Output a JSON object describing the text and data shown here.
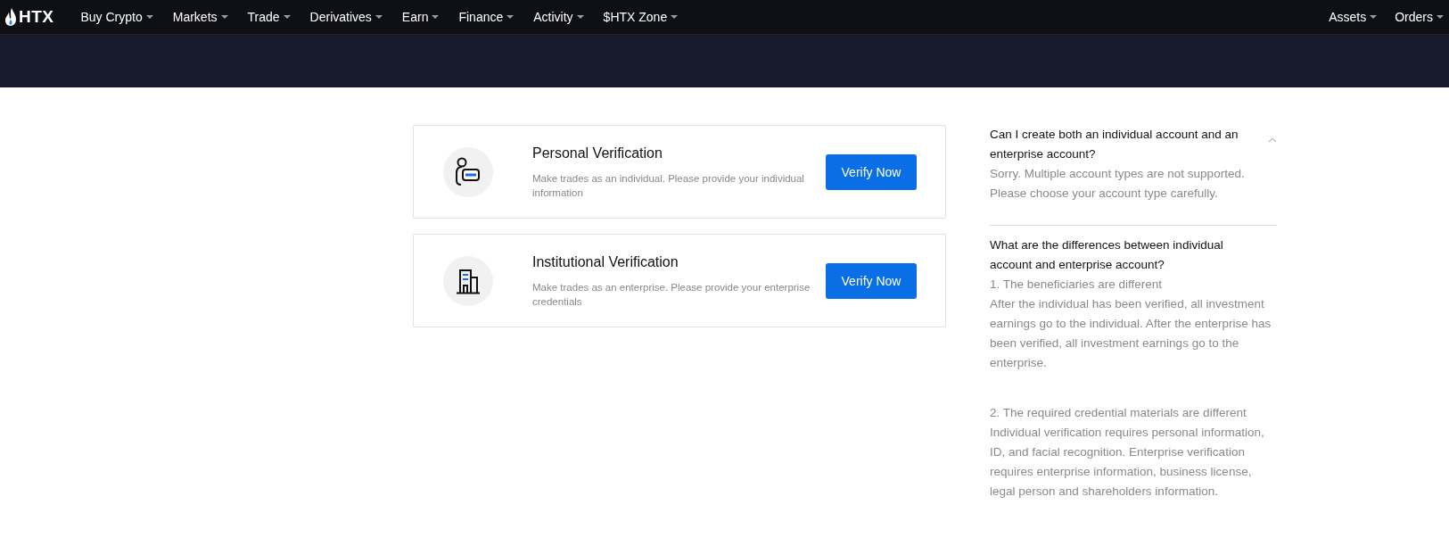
{
  "nav": {
    "logo": "HTX",
    "items": [
      {
        "label": "Buy Crypto"
      },
      {
        "label": "Markets"
      },
      {
        "label": "Trade"
      },
      {
        "label": "Derivatives"
      },
      {
        "label": "Earn"
      },
      {
        "label": "Finance"
      },
      {
        "label": "Activity"
      },
      {
        "label": "$HTX Zone"
      }
    ],
    "right_items": [
      {
        "label": "Assets"
      },
      {
        "label": "Orders"
      }
    ]
  },
  "cards": [
    {
      "kind": "personal",
      "title": "Personal Verification",
      "description": "Make trades as an individual. Please provide your individual information",
      "button": "Verify Now"
    },
    {
      "kind": "institutional",
      "title": "Institutional Verification",
      "description": "Make trades as an enterprise. Please provide your enterprise credentials",
      "button": "Verify Now"
    }
  ],
  "faq": [
    {
      "question": "Can I create both an individual account and an enterprise account?",
      "expanded": true,
      "answer": [
        {
          "heading": "Sorry. Multiple account types are not supported.",
          "text": "Please choose your account type carefully."
        }
      ]
    },
    {
      "question": "What are the differences between individual account and enterprise account?",
      "answer": [
        {
          "heading": "1. The beneficiaries are different",
          "text": "After the individual has been verified, all investment earnings go to the individual. After the enterprise has been verified, all investment earnings go to the enterprise."
        },
        {
          "heading": "2. The required credential materials are different",
          "text": "Individual verification requires personal information, ID, and facial recognition. Enterprise verification requires enterprise information, business license, legal person and shareholders information."
        }
      ]
    }
  ]
}
